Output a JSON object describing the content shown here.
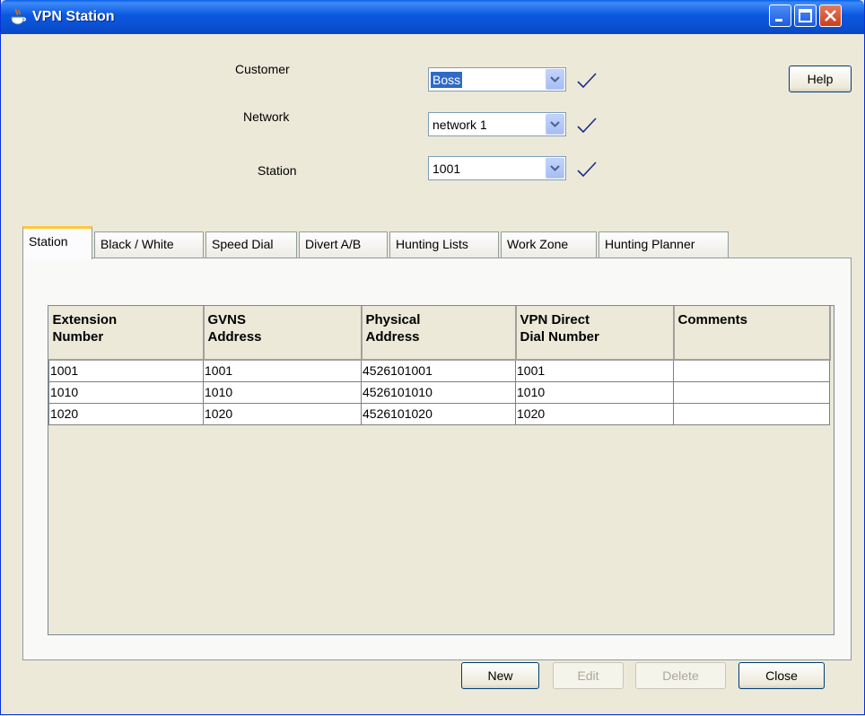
{
  "window": {
    "title": "VPN Station",
    "icon": "java-cup-icon"
  },
  "form": {
    "customer": {
      "label": "Customer",
      "value": "Boss"
    },
    "network": {
      "label": "Network",
      "value": "network 1"
    },
    "station": {
      "label": "Station",
      "value": "1001"
    }
  },
  "help_label": "Help",
  "tabs": [
    "Station",
    "Black / White",
    "Speed Dial",
    "Divert A/B",
    "Hunting Lists",
    "Work Zone",
    "Hunting Planner"
  ],
  "table": {
    "columns": [
      [
        "Extension",
        "Number"
      ],
      [
        "GVNS",
        "Address"
      ],
      [
        "Physical",
        "Address"
      ],
      [
        "VPN Direct",
        "Dial Number"
      ],
      [
        "Comments",
        ""
      ]
    ],
    "rows": [
      [
        "1001",
        "1001",
        "4526101001",
        "1001",
        ""
      ],
      [
        "1010",
        "1010",
        "4526101010",
        "1010",
        ""
      ],
      [
        "1020",
        "1020",
        "4526101020",
        "1020",
        ""
      ]
    ]
  },
  "buttons": {
    "new": "New",
    "edit": "Edit",
    "delete": "Delete",
    "close": "Close"
  },
  "colors": {
    "titlebar": "#0a5fe8",
    "tab_highlight": "#ffc73c",
    "selection": "#316ac5"
  }
}
